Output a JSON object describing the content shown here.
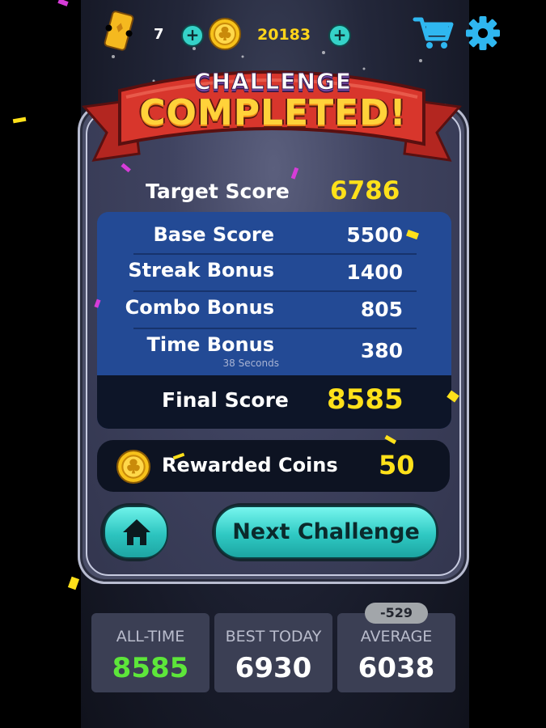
{
  "topbar": {
    "tickets": "7",
    "coins": "20183",
    "icons": [
      "ticket-icon",
      "plus-icon",
      "coin-icon",
      "plus-icon",
      "cart-icon",
      "gear-icon"
    ]
  },
  "banner": {
    "line1": "CHALLENGE",
    "line2": "COMPLETED!"
  },
  "target": {
    "label": "Target Score",
    "value": "6786"
  },
  "breakdown": [
    {
      "label": "Base Score",
      "value": "5500"
    },
    {
      "label": "Streak Bonus",
      "value": "1400"
    },
    {
      "label": "Combo Bonus",
      "value": "805"
    },
    {
      "label": "Time Bonus",
      "value": "380",
      "sub": "38 Seconds"
    }
  ],
  "final": {
    "label": "Final Score",
    "value": "8585"
  },
  "reward": {
    "label": "Rewarded Coins",
    "value": "50"
  },
  "buttons": {
    "next_label": "Next Challenge"
  },
  "stats": [
    {
      "label": "ALL-TIME",
      "value": "8585"
    },
    {
      "label": "BEST TODAY",
      "value": "6930"
    },
    {
      "label": "AVERAGE",
      "value": "6038",
      "badge": "-529"
    }
  ],
  "colors": {
    "accent_teal": "#2fc9c3",
    "score_yellow": "#ffe11a",
    "alltime_green": "#5de63a",
    "breakdown_blue": "#234a95",
    "banner_red": "#d8362c"
  }
}
